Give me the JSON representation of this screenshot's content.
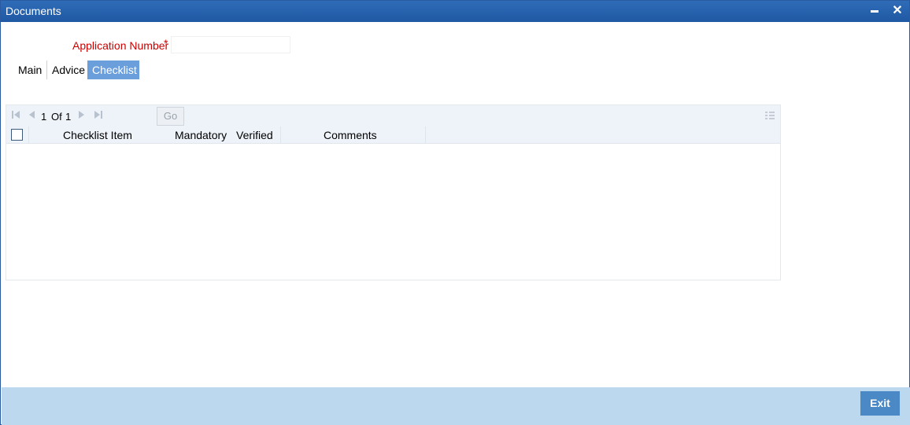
{
  "window": {
    "title": "Documents",
    "minimize_glyph": "▬",
    "close_glyph": "✕"
  },
  "form": {
    "app_number_label": "Application Number",
    "required_mark": "*",
    "app_number_value": ""
  },
  "tabs": [
    {
      "label": "Main",
      "active": false
    },
    {
      "label": "Advice",
      "active": false
    },
    {
      "label": "Checklist",
      "active": true
    }
  ],
  "grid": {
    "pager": {
      "current": "1",
      "of": "Of",
      "total": "1",
      "goto_value": "",
      "go_label": "Go"
    },
    "columns": [
      "Checklist Item",
      "Mandatory",
      "Verified",
      "Comments"
    ],
    "rows": []
  },
  "footer": {
    "exit_label": "Exit"
  },
  "colors": {
    "title_bar": "#1f58a3",
    "active_tab": "#6a9fdc",
    "footer": "#bcd8ee",
    "exit_button": "#4a88c6",
    "required_label": "#cc0000"
  }
}
